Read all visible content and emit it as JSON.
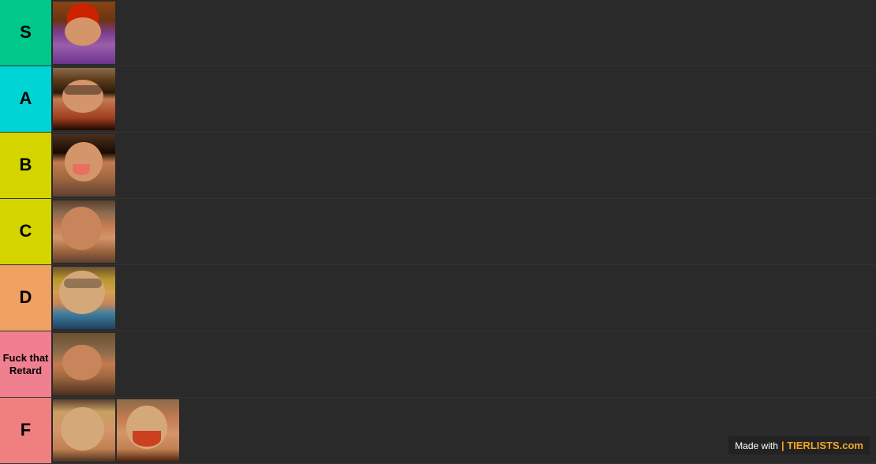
{
  "tiers": [
    {
      "id": "s",
      "label": "S",
      "color": "#00c78a",
      "textColor": "#000",
      "images": [
        "s1"
      ]
    },
    {
      "id": "a",
      "label": "A",
      "color": "#00d4d4",
      "textColor": "#000",
      "images": [
        "a1"
      ]
    },
    {
      "id": "b",
      "label": "B",
      "color": "#d4d400",
      "textColor": "#000",
      "images": [
        "b1"
      ]
    },
    {
      "id": "c",
      "label": "C",
      "color": "#d4d400",
      "textColor": "#000",
      "images": [
        "c1"
      ]
    },
    {
      "id": "d",
      "label": "D",
      "color": "#f0a060",
      "textColor": "#000",
      "images": [
        "d1"
      ]
    },
    {
      "id": "ftr",
      "label": "Fuck that Retard",
      "color": "#f08090",
      "textColor": "#000",
      "images": [
        "ftr1"
      ]
    },
    {
      "id": "f",
      "label": "F",
      "color": "#f08080",
      "textColor": "#000",
      "images": [
        "f1",
        "f2"
      ]
    }
  ],
  "watermark": {
    "made_with": "Made with",
    "logo": "| TIERLISTS.com"
  }
}
